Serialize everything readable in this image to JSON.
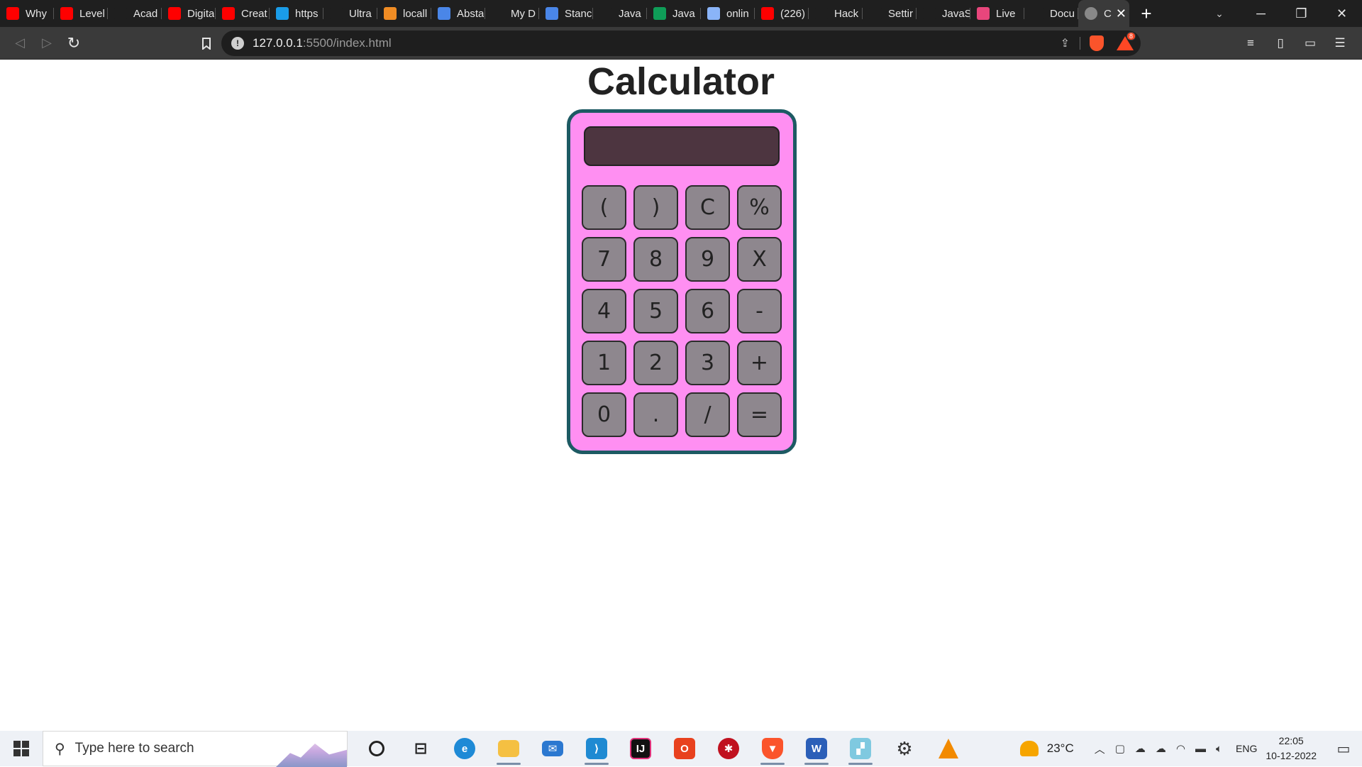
{
  "browser": {
    "tabs": [
      {
        "label": "Why",
        "fav_color": "#ff0000",
        "icon": "youtube-icon"
      },
      {
        "label": "Level",
        "fav_color": "#ff0000",
        "icon": "youtube-icon"
      },
      {
        "label": "Acad",
        "fav_color": "#1f1f1f",
        "icon": "letter-a-icon"
      },
      {
        "label": "Digita",
        "fav_color": "#ff0000",
        "icon": "youtube-icon"
      },
      {
        "label": "Creat",
        "fav_color": "#ff0000",
        "icon": "youtube-icon"
      },
      {
        "label": "https",
        "fav_color": "#1a9ce8",
        "icon": "globe-icon"
      },
      {
        "label": "Ultra",
        "fav_color": "#1f1f1f",
        "icon": "github-icon"
      },
      {
        "label": "locall",
        "fav_color": "#f08c24",
        "icon": "xampp-icon"
      },
      {
        "label": "Absta",
        "fav_color": "#4a86e8",
        "icon": "docs-icon"
      },
      {
        "label": "My D",
        "fav_color": "#1f1f1f",
        "icon": "drive-icon"
      },
      {
        "label": "Stanc",
        "fav_color": "#4a86e8",
        "icon": "docs-icon"
      },
      {
        "label": "Java",
        "fav_color": "#1f1f1f",
        "icon": "drive-icon"
      },
      {
        "label": "Java",
        "fav_color": "#0f9d58",
        "icon": "sheets-icon"
      },
      {
        "label": "onlin",
        "fav_color": "#8ab4f8",
        "icon": "info-icon"
      },
      {
        "label": "(226)",
        "fav_color": "#ff0000",
        "icon": "youtube-icon"
      },
      {
        "label": "Hack",
        "fav_color": "#1f1f1f",
        "icon": "hackerrank-icon"
      },
      {
        "label": "Settir",
        "fav_color": "#1f1f1f",
        "icon": "gear-icon"
      },
      {
        "label": "JavaS",
        "fav_color": "#1f1f1f",
        "icon": "globe-icon"
      },
      {
        "label": "Live",
        "fav_color": "#e8467c",
        "icon": "live-icon"
      },
      {
        "label": "Docu",
        "fav_color": "#1f1f1f",
        "icon": "globe-icon"
      }
    ],
    "active_tab": {
      "label": "C",
      "close": "✕"
    },
    "new_tab": "+",
    "url_host": "127.0.0.1",
    "url_path": ":5500/index.html",
    "rewards_badge": "8"
  },
  "page": {
    "title": "Calculator",
    "display_value": "",
    "keys": [
      "(",
      ")",
      "C",
      "%",
      "7",
      "8",
      "9",
      "X",
      "4",
      "5",
      "6",
      "-",
      "1",
      "2",
      "3",
      "+",
      "0",
      ".",
      "/",
      "="
    ]
  },
  "taskbar": {
    "search_placeholder": "Type here to search",
    "temperature": "23°C",
    "language": "ENG",
    "time": "22:05",
    "date": "10-12-2022"
  }
}
